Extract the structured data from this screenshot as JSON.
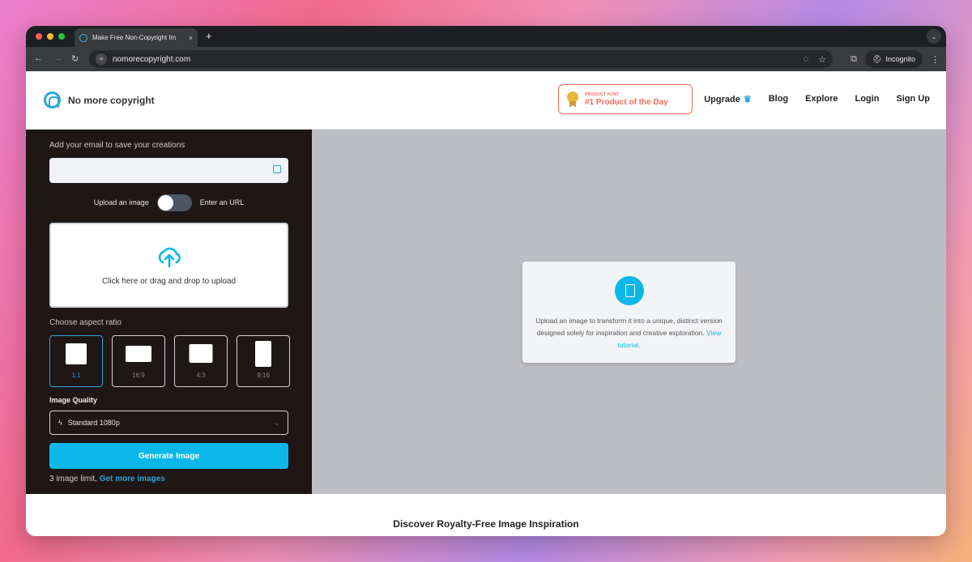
{
  "browser": {
    "tab_title": "Make Free Non-Copyright Im",
    "tab_close": "×",
    "new_tab": "+",
    "url": "nomorecopyright.com",
    "incognito_label": "Incognito"
  },
  "header": {
    "brand": "No more copyright",
    "product_hunt_small": "PRODUCT HUNT",
    "product_hunt_big": "#1 Product of the Day",
    "nav": [
      "Upgrade",
      "Blog",
      "Explore",
      "Login",
      "Sign Up"
    ]
  },
  "sidebar": {
    "email_label": "Add your email to save your creations",
    "email_value": "",
    "toggle_left": "Upload an image",
    "toggle_right": "Enter an URL",
    "upload_text": "Click here or drag and drop to upload",
    "aspect_label": "Choose aspect ratio",
    "ratios": [
      "1:1",
      "16:9",
      "4:3",
      "9:16"
    ],
    "selected_ratio": "1:1",
    "quality_label": "Image Quality",
    "quality_value": "Standard 1080p",
    "generate_label": "Generate Image",
    "limit_text": "3 image limit,",
    "limit_link": "Get more images"
  },
  "preview": {
    "message": "Upload an image to transform it into a unique, distinct version designed solely for inspiration and creative exploration.",
    "link": "View tutorial."
  },
  "footer": {
    "heading": "Discover Royalty-Free Image Inspiration"
  },
  "colors": {
    "accent": "#0ab7e8",
    "sidebar_bg": "#1f1616",
    "preview_bg": "#bdbec3",
    "product_hunt": "#ef6c5a"
  }
}
